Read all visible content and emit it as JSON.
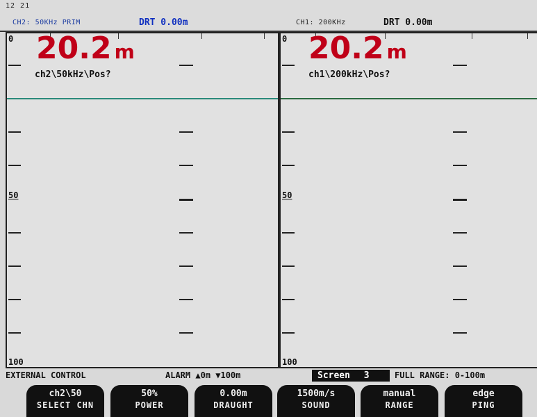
{
  "header": {
    "clock": "12 21",
    "ch2_label": "CH2: 50KHz PRIM",
    "ch2_drt": "DRT 0.00m",
    "ch1_label": "CH1: 200KHz",
    "ch1_drt": "DRT 0.00m"
  },
  "left_panel": {
    "depth_value": "20.2",
    "depth_unit": "m",
    "channel_name": "ch2\\50kHz\\Pos?",
    "scale_top": "0",
    "scale_mid": "50",
    "scale_bottom": "100"
  },
  "right_panel": {
    "depth_value": "20.2",
    "depth_unit": "m",
    "channel_name": "ch1\\200kHz\\Pos?",
    "scale_top": "0",
    "scale_mid": "50",
    "scale_bottom": "100"
  },
  "status": {
    "control": "EXTERNAL CONTROL",
    "alarm": "ALARM ▲0m  ▼100m",
    "screen_label": "Screen",
    "screen_num": "3",
    "range": "FULL RANGE: 0-100m"
  },
  "softkeys": [
    {
      "value": "ch2\\50",
      "label": "SELECT CHN"
    },
    {
      "value": "50%",
      "label": "POWER"
    },
    {
      "value": "0.00m",
      "label": "DRAUGHT"
    },
    {
      "value": "1500m/s",
      "label": "SOUND"
    },
    {
      "value": "manual",
      "label": "RANGE"
    },
    {
      "value": "edge",
      "label": "PING"
    }
  ],
  "colors": {
    "depth_red": "#c00018",
    "drt_blue": "#1030c0",
    "bottom_line": "#2a8a7a"
  }
}
